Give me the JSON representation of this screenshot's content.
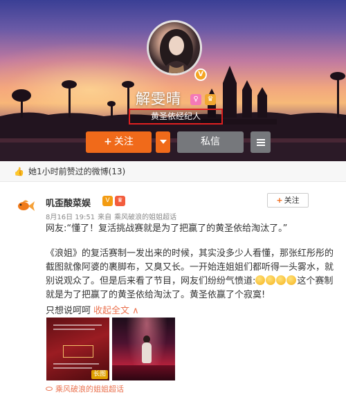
{
  "profile": {
    "name": "解雯晴",
    "bio": "黄圣依经纪人",
    "avatar_icon": "avatar-portrait",
    "verified_badge_icon": "v-badge-icon"
  },
  "actions": {
    "follow_label": "关注",
    "message_label": "私信"
  },
  "liked_bar": {
    "text": "她1小时前赞过的微博(13)"
  },
  "post": {
    "author": "叽歪酸菜娱",
    "follow_label": "关注",
    "date": "8月16日 19:51",
    "source_prefix": "来自",
    "source": "乘风破浪的姐姐超话",
    "quote": "网友:“懂了！复活挑战赛就是为了把赢了的黄圣依给淘汰了。”",
    "body_part1": "《浪姐》的复活赛制一发出来的时候，其实没多少人看懂，那张红彤彤的截图就像阿婆的裹脚布，又臭又长。一开始连姐姐们都听得一头雾水，就别说观众了。但是后来看了节目，网友们纷纷气愤道:",
    "body_part2": "这个赛制就是为了把赢了的黄圣依给淘汰了。黄圣依赢了个寂寞!",
    "last_line": "只想说呵呵",
    "collapse_label": "收起全文",
    "collapse_arrow": "∧",
    "long_image_tag": "长图",
    "footer_tag": "乘风破浪的姐姐超话"
  },
  "colors": {
    "accent_orange": "#f06a1a",
    "link_orange": "#eb7350",
    "highlight_red": "#e02020",
    "button_gray": "#76787c"
  }
}
